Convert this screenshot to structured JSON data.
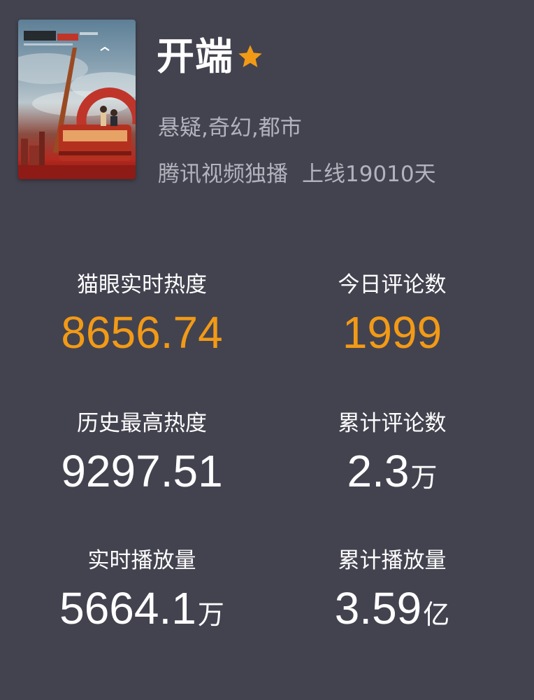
{
  "show": {
    "title": "开端",
    "genres": "悬疑,奇幻,都市",
    "platform": "腾讯视频独播",
    "online_days": "上线19010天",
    "poster_icon": "drama-poster",
    "star_icon": "star-icon",
    "star_color": "#f29a16"
  },
  "stats": {
    "realtime_heat": {
      "label": "猫眼实时热度",
      "value": "8656.74"
    },
    "today_comments": {
      "label": "今日评论数",
      "value": "1999"
    },
    "history_max_heat": {
      "label": "历史最高热度",
      "value": "9297.51"
    },
    "total_comments": {
      "label": "累计评论数",
      "value": "2.3",
      "unit": "万"
    },
    "realtime_plays": {
      "label": "实时播放量",
      "value": "5664.1",
      "unit": "万"
    },
    "total_plays": {
      "label": "累计播放量",
      "value": "3.59",
      "unit": "亿"
    }
  },
  "colors": {
    "background": "#434350",
    "accent": "#f29a16",
    "muted_text": "#b3b3bd"
  }
}
